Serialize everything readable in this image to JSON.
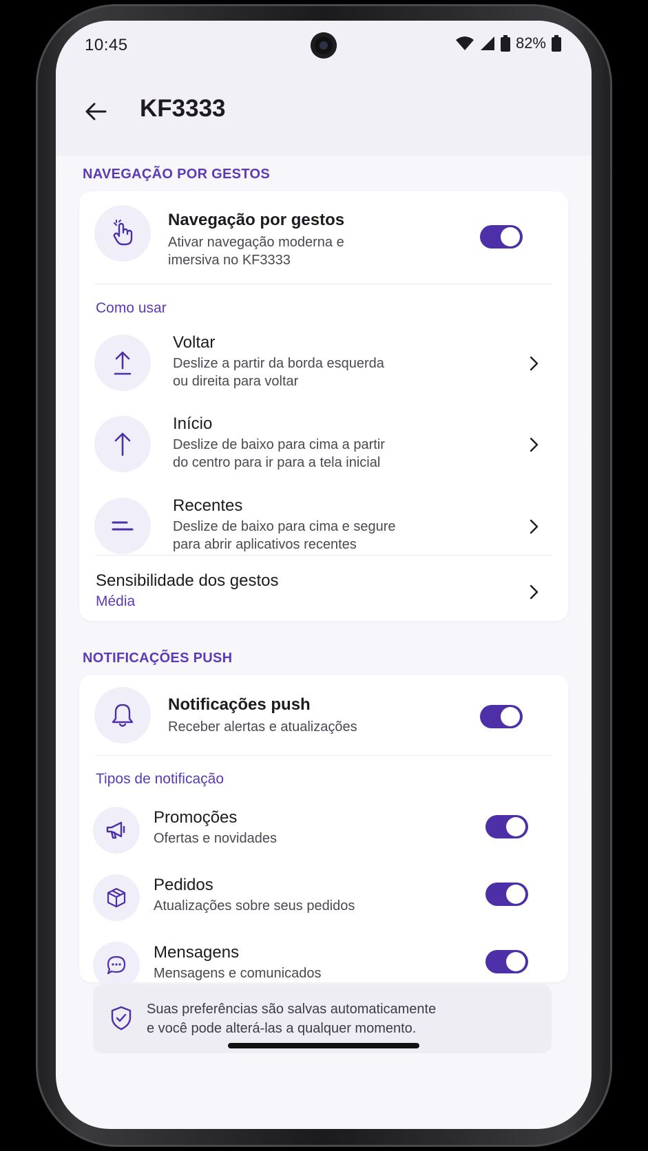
{
  "status_bar": {
    "time": "10:45",
    "battery_percent": "82%",
    "icons": [
      "wifi-icon",
      "signal-icon",
      "battery-icon"
    ]
  },
  "app_bar": {
    "title": "KF3333",
    "back_icon": "arrow-left-icon"
  },
  "gesture_section": {
    "header": "NAVEGAÇÃO POR GESTOS",
    "main_toggle": {
      "title": "Navegação por gestos",
      "subtitle_line1": "Ativar navegação moderna e",
      "subtitle_line2": "imersiva no KF3333",
      "icon": "hand-pointer-icon",
      "enabled": true
    },
    "how_to_label": "Como usar",
    "items": [
      {
        "title": "Voltar",
        "line1": "Deslize a partir da borda esquerda",
        "line2": "ou direita para voltar",
        "icon": "upload-arrow-icon"
      },
      {
        "title": "Início",
        "line1": "Deslize de baixo para cima a partir",
        "line2": "do centro para ir para a tela inicial",
        "icon": "arrow-up-icon"
      },
      {
        "title": "Recentes",
        "line1": "Deslize de baixo para cima e segure",
        "line2": "para abrir aplicativos recentes",
        "icon": "recents-lines-icon"
      }
    ],
    "sensitivity": {
      "title": "Sensibilidade dos gestos",
      "value": "Média"
    }
  },
  "push_section": {
    "header": "NOTIFICAÇÕES PUSH",
    "main_toggle": {
      "title": "Notificações push",
      "subtitle": "Receber alertas e atualizações",
      "icon": "bell-icon",
      "enabled": true
    },
    "types_label": "Tipos de notificação",
    "types": [
      {
        "title": "Promoções",
        "subtitle": "Ofertas e novidades",
        "icon": "megaphone-icon",
        "enabled": true
      },
      {
        "title": "Pedidos",
        "subtitle": "Atualizações sobre seus pedidos",
        "icon": "box-icon",
        "enabled": true
      },
      {
        "title": "Mensagens",
        "subtitle": "Mensagens e comunicados",
        "icon": "chat-bubble-icon",
        "enabled": true
      }
    ]
  },
  "info": {
    "line1": "Suas preferências são salvas automaticamente",
    "line2": "e você pode alterá-las a qualquer momento.",
    "icon": "shield-check-icon"
  },
  "colors": {
    "accent": "#5b3bb5",
    "toggle_on": "#4d2fa8",
    "icon_bg": "#f0eef8",
    "screen_bg": "#f7f6fa"
  }
}
